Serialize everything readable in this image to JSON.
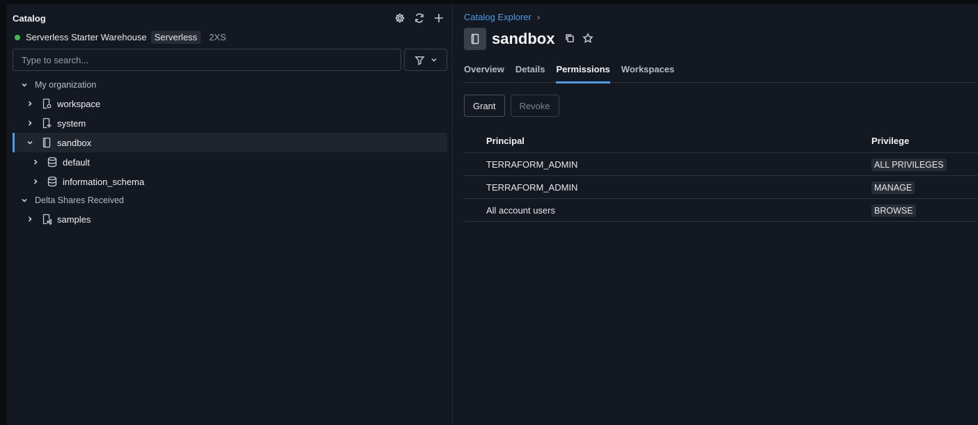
{
  "sidebar": {
    "title": "Catalog",
    "warehouse": {
      "name": "Serverless Starter Warehouse",
      "badge": "Serverless",
      "size": "2XS",
      "status_color": "#3fb950"
    },
    "search": {
      "placeholder": "Type to search..."
    },
    "tree": {
      "my_org": "My organization",
      "workspace": "workspace",
      "system": "system",
      "sandbox": "sandbox",
      "default": "default",
      "information_schema": "information_schema",
      "delta_shares": "Delta Shares Received",
      "samples": "samples"
    }
  },
  "main": {
    "breadcrumb": {
      "root": "Catalog Explorer",
      "separator": "›"
    },
    "title": "sandbox",
    "tabs": {
      "overview": "Overview",
      "details": "Details",
      "permissions": "Permissions",
      "workspaces": "Workspaces"
    },
    "actions": {
      "grant": "Grant",
      "revoke": "Revoke"
    },
    "table": {
      "headers": {
        "principal": "Principal",
        "privilege": "Privilege"
      },
      "rows": [
        {
          "principal": "TERRAFORM_ADMIN",
          "privilege": "ALL PRIVILEGES"
        },
        {
          "principal": "TERRAFORM_ADMIN",
          "privilege": "MANAGE"
        },
        {
          "principal": "All account users",
          "privilege": "BROWSE"
        }
      ]
    }
  },
  "colors": {
    "accent": "#4c9be8",
    "background": "#141821"
  }
}
